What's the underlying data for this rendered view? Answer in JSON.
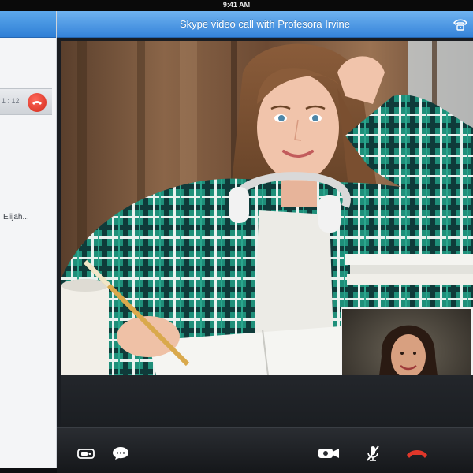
{
  "status_bar": {
    "time": "9:41 AM"
  },
  "left_panel": {
    "call_time": "1 : 12",
    "contact_name": "Elijah..."
  },
  "call": {
    "title": "Skype video call with Profesora Irvine"
  },
  "icons": {
    "header_right": "phone-handset-icon",
    "left_end_call": "end-call-icon",
    "toolbar": [
      "video-toggle-icon",
      "chat-bubble-icon",
      "camera-switch-icon",
      "mute-microphone-icon",
      "end-call-icon"
    ]
  },
  "colors": {
    "header_blue": "#3583d9",
    "end_call_red": "#e0372a",
    "toolbar_bg": "#1b1e22"
  }
}
